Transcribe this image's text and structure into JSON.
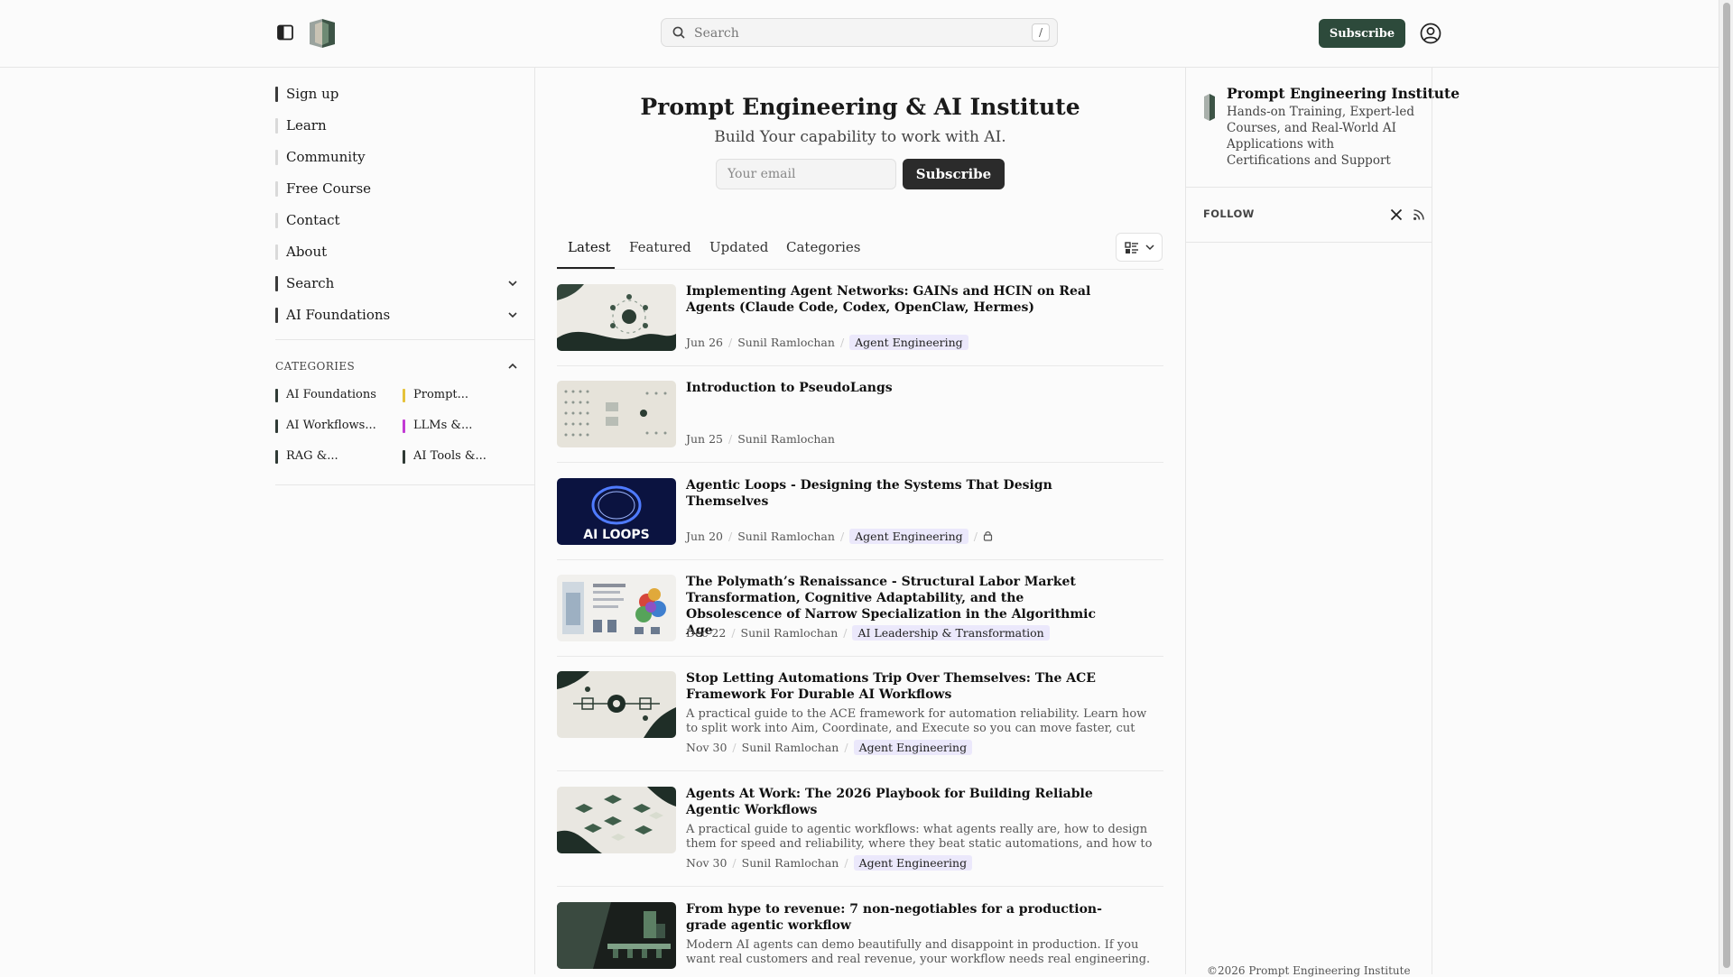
{
  "search": {
    "placeholder": "Search",
    "shortcut": "/"
  },
  "header": {
    "subscribe_label": "Subscribe"
  },
  "nav": [
    {
      "label": "Sign up",
      "color": "#3a3a3a"
    },
    {
      "label": "Learn",
      "color": "#d9d9d9"
    },
    {
      "label": "Community",
      "color": "#d9d9d9"
    },
    {
      "label": "Free Course",
      "color": "#d9d9d9"
    },
    {
      "label": "Contact",
      "color": "#d9d9d9"
    },
    {
      "label": "About",
      "color": "#d9d9d9"
    },
    {
      "label": "Search",
      "color": "#3a3a3a",
      "expandable": true
    },
    {
      "label": "AI Foundations",
      "color": "#3a3a3a",
      "expandable": true
    }
  ],
  "categories": {
    "heading": "CATEGORIES",
    "items": [
      {
        "label": "AI Foundations",
        "color": "#2f3a35"
      },
      {
        "label": "Prompt...",
        "color": "#e5c23a"
      },
      {
        "label": "AI Workflows...",
        "color": "#2f3a35"
      },
      {
        "label": "LLMs &...",
        "color": "#c23bd4"
      },
      {
        "label": "RAG &...",
        "color": "#2f3a35"
      },
      {
        "label": "AI Tools &...",
        "color": "#2f3a35"
      }
    ]
  },
  "hero": {
    "title": "Prompt Engineering & AI Institute",
    "subtitle": "Build Your capability to work with AI.",
    "email_placeholder": "Your email",
    "subscribe_label": "Subscribe"
  },
  "tabs": [
    {
      "label": "Latest",
      "active": true
    },
    {
      "label": "Featured"
    },
    {
      "label": "Updated"
    },
    {
      "label": "Categories"
    }
  ],
  "posts": [
    {
      "title": "Implementing Agent Networks: GAINs and HCIN on Real Agents (Claude Code, Codex, OpenClaw, Hermes)",
      "excerpt": "",
      "date": "Jun 26",
      "author": "Sunil Ramlochan",
      "tag": "Agent Engineering",
      "locked": false
    },
    {
      "title": "Introduction to PseudoLangs",
      "excerpt": "",
      "date": "Jun 25",
      "author": "Sunil Ramlochan",
      "tag": "",
      "locked": false
    },
    {
      "title": "Agentic Loops - Designing the Systems That Design Themselves",
      "excerpt": "",
      "date": "Jun 20",
      "author": "Sunil Ramlochan",
      "tag": "Agent Engineering",
      "locked": true,
      "thumb_text": "AI LOOPS"
    },
    {
      "title": "The Polymath’s Renaissance - Structural Labor Market Transformation, Cognitive Adaptability, and the Obsolescence of Narrow Specialization in the Algorithmic Age",
      "excerpt": "",
      "date": "Dec 22",
      "author": "Sunil Ramlochan",
      "tag": "AI Leadership & Transformation",
      "locked": false
    },
    {
      "title": "Stop Letting Automations Trip Over Themselves: The ACE Framework For Durable AI Workflows",
      "excerpt": "A practical guide to the ACE framework for automation reliability. Learn how to split work into Aim, Coordinate, and Execute so you can move faster, cut MTTR, and keep...",
      "date": "Nov 30",
      "author": "Sunil Ramlochan",
      "tag": "Agent Engineering",
      "locked": false
    },
    {
      "title": "Agents At Work: The 2026 Playbook for Building Reliable Agentic Workflows",
      "excerpt": "A practical guide to agentic workflows: what agents really are, how to design them for speed and reliability, where they beat static automations, and how to make them...",
      "date": "Nov 30",
      "author": "Sunil Ramlochan",
      "tag": "Agent Engineering",
      "locked": false
    },
    {
      "title": "From hype to revenue: 7 non-negotiables for a production-grade agentic workflow",
      "excerpt": "Modern AI agents can demo beautifully and disappoint in production. If you want real customers and real revenue, your workflow needs real engineering. Here's seven non-...",
      "date": "",
      "author": "",
      "tag": "",
      "locked": false
    }
  ],
  "aside": {
    "title": "Prompt Engineering Institute",
    "description": "Hands-on Training, Expert-led Courses, and Real-World AI Applications with Certifications and Support",
    "follow_label": "FOLLOW",
    "copyright": "©2026 Prompt Engineering Institute"
  },
  "colors": {
    "accent": "#2d4a3b",
    "tag_bg": "#ebe8fb",
    "dark_button": "#2b2b2b"
  }
}
